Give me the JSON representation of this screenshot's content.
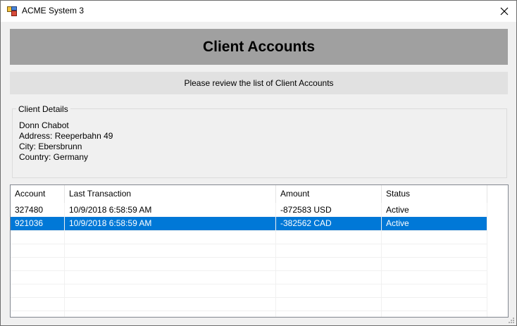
{
  "window": {
    "title": "ACME System 3",
    "app_icon": "app-window-icon",
    "close_icon": "close-icon"
  },
  "header": {
    "title": "Client Accounts"
  },
  "subheader": {
    "text": "Please review the list of Client Accounts"
  },
  "client_details": {
    "legend": "Client Details",
    "name": "Donn Chabot",
    "address": "Address: Reeperbahn 49",
    "city": "City: Ebersbrunn",
    "country": "Country: Germany"
  },
  "accounts_list": {
    "columns": [
      "Account",
      "Last Transaction",
      "Amount",
      "Status"
    ],
    "rows": [
      {
        "account": "327480",
        "last_transaction": "10/9/2018 6:58:59 AM",
        "amount": "-872583 USD",
        "status": "Active",
        "selected": false
      },
      {
        "account": "921036",
        "last_transaction": "10/9/2018 6:58:59 AM",
        "amount": "-382562 CAD",
        "status": "Active",
        "selected": true
      }
    ]
  },
  "colors": {
    "selection": "#0078d7",
    "header_banner": "#a0a0a0",
    "sub_banner": "#e1e1e1"
  }
}
